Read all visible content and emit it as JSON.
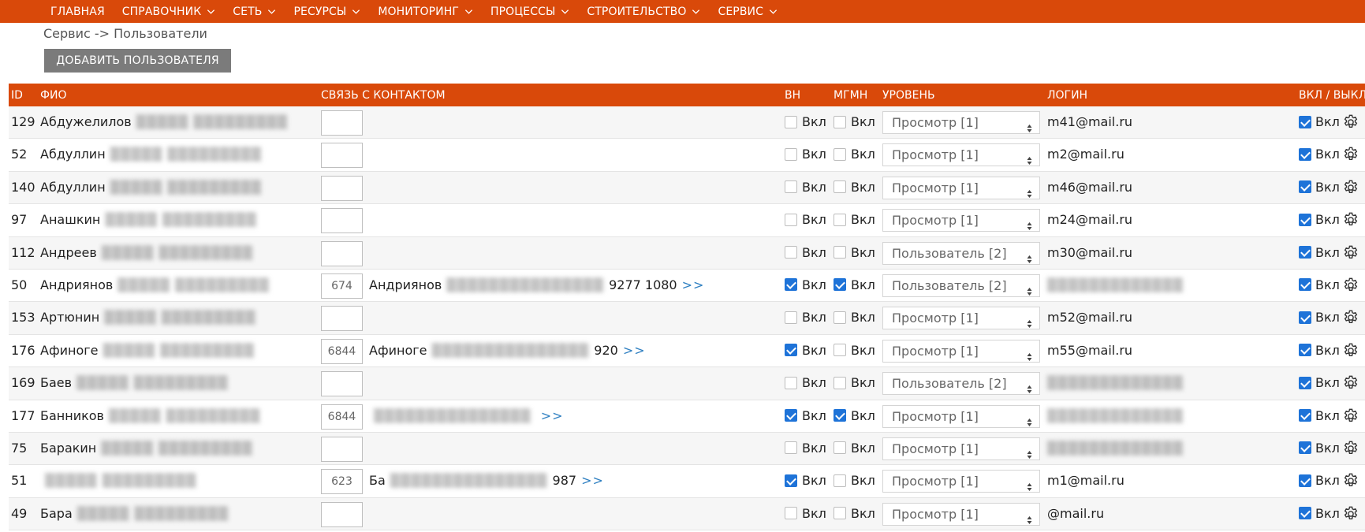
{
  "nav": {
    "items": [
      {
        "label": "ГЛАВНАЯ",
        "has_menu": false
      },
      {
        "label": "СПРАВОЧНИК",
        "has_menu": true
      },
      {
        "label": "СЕТЬ",
        "has_menu": true
      },
      {
        "label": "РЕСУРСЫ",
        "has_menu": true
      },
      {
        "label": "МОНИТОРИНГ",
        "has_menu": true
      },
      {
        "label": "ПРОЦЕССЫ",
        "has_menu": true
      },
      {
        "label": "СТРОИТЕЛЬСТВО",
        "has_menu": true
      },
      {
        "label": "СЕРВИС",
        "has_menu": true
      }
    ]
  },
  "breadcrumb": "Сервис -> Пользователи",
  "add_button_label": "ДОБАВИТЬ ПОЛЬЗОВАТЕЛЯ",
  "table": {
    "headers": {
      "id": "ID",
      "name": "ФИО",
      "contact": "СВЯЗЬ С КОНТАКТОМ",
      "vn": "ВН",
      "mgmn": "МГМН",
      "level": "УРОВЕНЬ",
      "login": "ЛОГИН",
      "onoff": "ВКЛ / ВЫКЛ"
    },
    "checkbox_label": "Вкл",
    "rows": [
      {
        "id": "129",
        "name": "Абдужелилов",
        "contact_id": "",
        "contact_text": "",
        "contact_tail": "",
        "vn": false,
        "mgmn": false,
        "level": "Просмотр [1]",
        "login": "m41@mail.ru",
        "enabled": true
      },
      {
        "id": "52",
        "name": "Абдуллин",
        "contact_id": "",
        "contact_text": "",
        "contact_tail": "",
        "vn": false,
        "mgmn": false,
        "level": "Просмотр [1]",
        "login": "m2@mail.ru",
        "enabled": true
      },
      {
        "id": "140",
        "name": "Абдуллин",
        "contact_id": "",
        "contact_text": "",
        "contact_tail": "",
        "vn": false,
        "mgmn": false,
        "level": "Просмотр [1]",
        "login": "m46@mail.ru",
        "enabled": true
      },
      {
        "id": "97",
        "name": "Анашкин",
        "contact_id": "",
        "contact_text": "",
        "contact_tail": "",
        "vn": false,
        "mgmn": false,
        "level": "Просмотр [1]",
        "login": "m24@mail.ru",
        "enabled": true
      },
      {
        "id": "112",
        "name": "Андреев",
        "contact_id": "",
        "contact_text": "",
        "contact_tail": "",
        "vn": false,
        "mgmn": false,
        "level": "Пользователь [2]",
        "login": "m30@mail.ru",
        "enabled": true
      },
      {
        "id": "50",
        "name": "Андриянов",
        "contact_id": "674",
        "contact_text": "Андриянов",
        "contact_tail": "9277 1080",
        "vn": true,
        "mgmn": true,
        "level": "Пользователь [2]",
        "login": "",
        "enabled": true
      },
      {
        "id": "153",
        "name": "Артюнин",
        "contact_id": "",
        "contact_text": "",
        "contact_tail": "",
        "vn": false,
        "mgmn": false,
        "level": "Просмотр [1]",
        "login": "m52@mail.ru",
        "enabled": true
      },
      {
        "id": "176",
        "name": "Афиноге",
        "contact_id": "6844",
        "contact_text": "Афиноге",
        "contact_tail": "920",
        "vn": true,
        "mgmn": false,
        "level": "Просмотр [1]",
        "login": "m55@mail.ru",
        "enabled": true
      },
      {
        "id": "169",
        "name": "Баев",
        "contact_id": "",
        "contact_text": "",
        "contact_tail": "",
        "vn": false,
        "mgmn": false,
        "level": "Пользователь [2]",
        "login": "",
        "enabled": true
      },
      {
        "id": "177",
        "name": "Банников",
        "contact_id": "6844",
        "contact_text": "",
        "contact_tail": "",
        "vn": true,
        "mgmn": true,
        "level": "Просмотр [1]",
        "login": "",
        "enabled": true
      },
      {
        "id": "75",
        "name": "Баракин",
        "contact_id": "",
        "contact_text": "",
        "contact_tail": "",
        "vn": false,
        "mgmn": false,
        "level": "Просмотр [1]",
        "login": "",
        "enabled": true
      },
      {
        "id": "51",
        "name": "",
        "contact_id": "623",
        "contact_text": "Ба",
        "contact_tail": "987",
        "vn": true,
        "mgmn": false,
        "level": "Просмотр [1]",
        "login": "m1@mail.ru",
        "enabled": true
      },
      {
        "id": "49",
        "name": "Бара",
        "contact_id": "",
        "contact_text": "",
        "contact_tail": "",
        "vn": false,
        "mgmn": false,
        "level": "Просмотр [1]",
        "login": "@mail.ru",
        "enabled": true
      }
    ]
  },
  "more_label": ">>",
  "colors": {
    "accent": "#d9490a",
    "button_gray": "#7b7b7b",
    "checkbox_on": "#1e73d8",
    "link": "#2e7fc1"
  },
  "icons": {
    "menu_chevron": "chevron-down-icon",
    "settings": "gear-icon",
    "select_arrows": "updown-arrows-icon"
  }
}
